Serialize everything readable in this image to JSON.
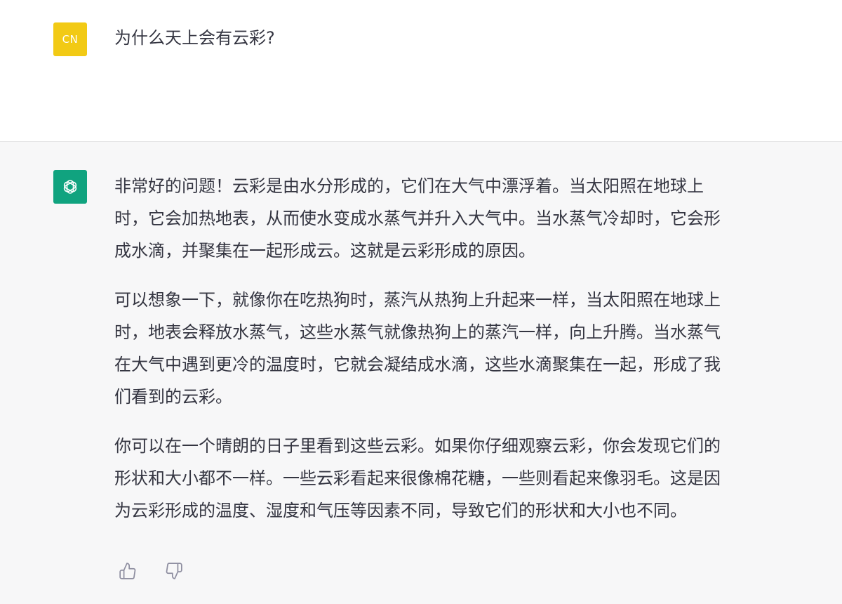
{
  "user": {
    "avatar_text": "CN",
    "message": "为什么天上会有云彩?"
  },
  "assistant": {
    "paragraphs": [
      {
        "lines": [
          "非常好的问题！云彩是由水分形成的，它们在大气中漂浮着。当太阳照在地球上",
          "时，它会加热地表，从而使水变成水蒸气并升入大气中。当水蒸气冷却时，它会形",
          "成水滴，并聚集在一起形成云。这就是云彩形成的原因。"
        ]
      },
      {
        "lines": [
          "可以想象一下，就像你在吃热狗时，蒸汽从热狗上升起来一样，当太阳照在地球上",
          "时，地表会释放水蒸气，这些水蒸气就像热狗上的蒸汽一样，向上升腾。当水蒸气",
          "在大气中遇到更冷的温度时，它就会凝结成水滴，这些水滴聚集在一起，形成了我",
          "们看到的云彩。"
        ]
      },
      {
        "lines": [
          "你可以在一个晴朗的日子里看到这些云彩。如果你仔细观察云彩，你会发现它们的",
          "形状和大小都不一样。一些云彩看起来很像棉花糖，一些则看起来像羽毛。这是因",
          "为云彩形成的温度、湿度和气压等因素不同，导致它们的形状和大小也不同。"
        ]
      }
    ]
  },
  "icons": {
    "assistant_avatar": "openai-logo-icon",
    "thumbs_up": "thumbs-up-icon",
    "thumbs_down": "thumbs-down-icon"
  },
  "colors": {
    "user_avatar_bg": "#f2ca15",
    "assistant_avatar_bg": "#10a37f",
    "assistant_bg": "#f7f7f8",
    "text": "#343541"
  }
}
